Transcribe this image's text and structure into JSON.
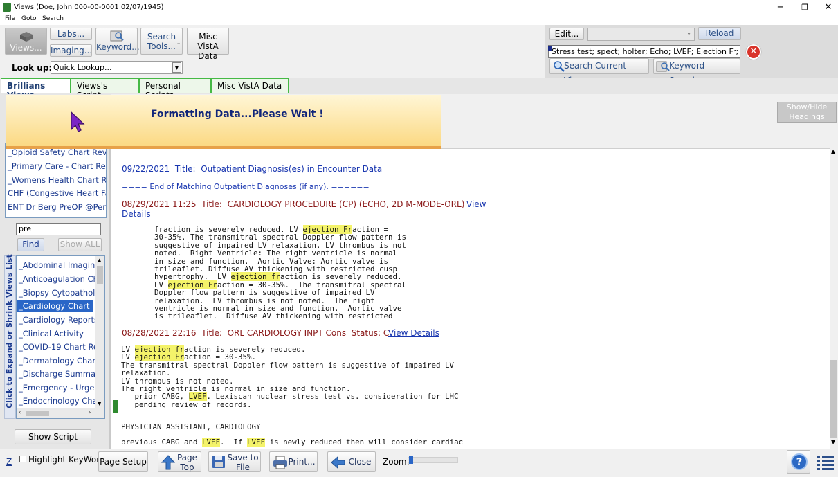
{
  "window": {
    "title": "Views (Doe, John  000-00-0001  02/07/1945)",
    "minimize": "−",
    "restore": "❐",
    "close": "✕"
  },
  "menu": [
    "File",
    "Goto",
    "Search"
  ],
  "toolbar": {
    "views": "Views...",
    "labs": "Labs...",
    "imaging": "Imaging...",
    "keyword": "Keyword...",
    "search_tools_1": "Search",
    "search_tools_2": "Tools...",
    "misc_vista_1": "Misc VistA",
    "misc_vista_2": "Data",
    "lookup_label": "Look up:",
    "lookup_value": "Quick Lookup..."
  },
  "search_panel": {
    "edit": "Edit...",
    "reload": "Reload",
    "search_text": "Stress test; spect; holter; Echo; LVEF; Ejection Fr; MU",
    "search_current_view": "Search Current View",
    "keyword_search": "Keyword Search..."
  },
  "tabs": [
    "Brillians Views",
    "Views's Script",
    "Personal Scripts",
    "Misc VistA Data"
  ],
  "overlay": {
    "message": "Formatting Data...Please Wait !"
  },
  "show_hide": {
    "line1": "Show/Hide",
    "line2": "Headings"
  },
  "left": {
    "top_list": [
      "_Opioid Safety Chart Review",
      "_Primary Care - Chart Review",
      "_Womens Health Chart Review",
      "CHF (Congestive Heart Fail C",
      "ENT Dr Berg PreOP @Person"
    ],
    "filter_value": "pre",
    "find": "Find",
    "show_all": "Show ALL",
    "vertical_label": "Click to Expand or Shrink Views List",
    "views_list": [
      "_Abdominal Imaging (",
      "_Anticoagulation Chart",
      "_Biopsy Cytopathology",
      "_Cardiology Chart Rev",
      "_Cardiology Reports",
      "_Clinical Activity",
      "_COVID-19 Chart Rev",
      "_Dermatology Chart R",
      "_Discharge Summaries",
      "_Emergency - Urgent",
      "_Endocrinology Chart F"
    ],
    "selected_index": 3,
    "show_script": "Show Script"
  },
  "doc": {
    "entry1": {
      "date": "09/22/2021",
      "title_label": "Title:",
      "title": "Outpatient Diagnosis(es) in Encounter Data"
    },
    "end_line": "==== End of Matching Outpatient Diagnoses (if any). ======",
    "entry2": {
      "date": "08/29/2021 11:25",
      "title_label": "Title:",
      "title": "CARDIOLOGY PROCEDURE (CP) (ECHO, 2D M-MODE-ORL)",
      "view": "View",
      "details": "Details"
    },
    "entry3": {
      "date": "08/28/2021 22:16",
      "title_label": "Title:",
      "title": "ORL CARDIOLOGY INPT Cons",
      "status": "Status: C",
      "view_details": "View Details"
    },
    "pa_line": "PHYSICIAN ASSISTANT, CARDIOLOGY"
  },
  "bottom": {
    "z": "Z",
    "highlight": "Highlight KeyWords",
    "page_setup": "Page Setup",
    "page_top_1": "Page",
    "page_top_2": "Top",
    "save_1": "Save to",
    "save_2": "File",
    "print": "Print...",
    "close": "Close",
    "zoom": "Zoom:",
    "help": "?"
  },
  "colors": {
    "accent_green": "#45b945",
    "link_blue": "#1a37b0",
    "title_red": "#8a1818",
    "highlight": "#f4f36a",
    "overlay_border": "#e7a149"
  }
}
